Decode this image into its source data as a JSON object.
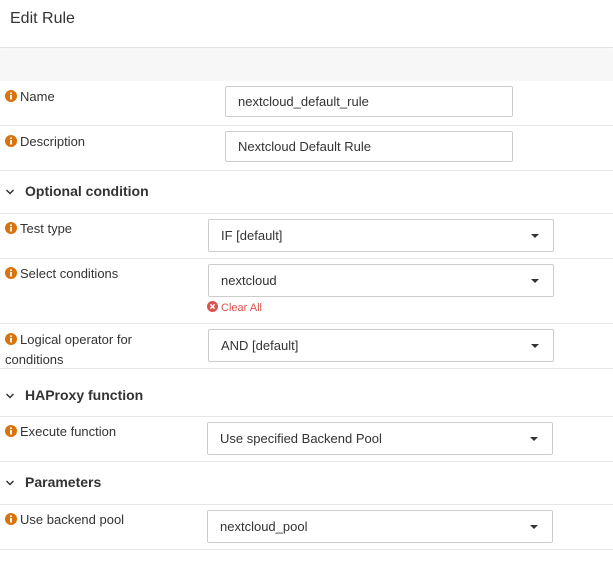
{
  "header": {
    "title": "Edit Rule"
  },
  "fields": {
    "name": {
      "label": "Name",
      "value": "nextcloud_default_rule"
    },
    "description": {
      "label": "Description",
      "value": "Nextcloud Default Rule"
    }
  },
  "sections": {
    "optional_condition": {
      "title": "Optional condition",
      "test_type": {
        "label": "Test type",
        "value": "IF [default]"
      },
      "select_conditions": {
        "label": "Select conditions",
        "value": "nextcloud",
        "clear_all": "Clear All"
      },
      "logical_operator": {
        "label_line1": "Logical operator for",
        "label_line2": "conditions",
        "value": "AND [default]"
      }
    },
    "haproxy_function": {
      "title": "HAProxy function",
      "execute_function": {
        "label": "Execute function",
        "value": "Use specified Backend Pool"
      }
    },
    "parameters": {
      "title": "Parameters",
      "use_backend_pool": {
        "label": "Use backend pool",
        "value": "nextcloud_pool"
      }
    }
  },
  "colors": {
    "info_icon": "#d9730d",
    "clear_all": "#d9534f",
    "text": "#333333",
    "border": "#cccccc"
  }
}
